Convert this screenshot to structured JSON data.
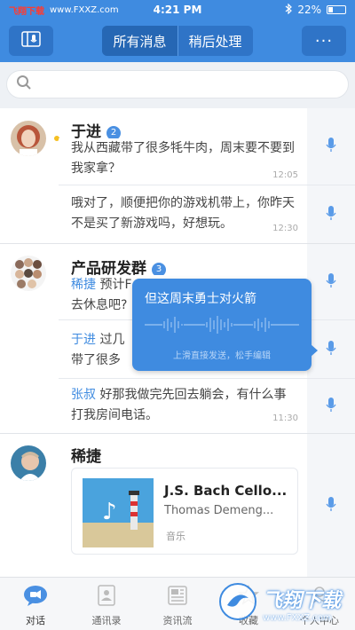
{
  "status_bar": {
    "watermark_text": "飞翔下载",
    "watermark_url": "www.FXXZ.com",
    "time": "4:21 PM",
    "battery": "22%"
  },
  "navbar": {
    "tabs": [
      {
        "label": "所有消息",
        "active": true
      },
      {
        "label": "稍后处理",
        "active": false
      }
    ],
    "more_label": "···"
  },
  "conversations": [
    {
      "name": "于进",
      "badge": "2",
      "messages": [
        {
          "text": "我从西藏带了很多牦牛肉，周末要不要到我家拿？",
          "time": "12:05"
        },
        {
          "text": "哦对了，顺便把你的游戏机带上，你昨天不是买了新游戏吗，好想玩。",
          "time": "12:30"
        }
      ]
    },
    {
      "name": "产品研发群",
      "badge": "3",
      "messages": [
        {
          "sender": "稀捷",
          "text": " 预计F...去休息吧?",
          "line1": " 预计F",
          "line2": "去休息吧?",
          "time": ""
        },
        {
          "sender": "于进",
          "text": " 过几...带了很多",
          "line1": " 过几",
          "line2": "带了很多",
          "time": ""
        },
        {
          "sender": "张叔",
          "text": " 好那我做完先回去躺会，有什么事打我房间电话。",
          "line1": " 好那我做完先回去躺会，有什么事",
          "line2": "打我房间电话。",
          "time": "11:30"
        }
      ]
    },
    {
      "name": "稀捷",
      "music": {
        "title": "J.S. Bach Cello...",
        "artist": "Thomas Demeng...",
        "category": "音乐"
      }
    }
  ],
  "voice_popup": {
    "text": "但这周末勇士对火箭",
    "hint": "上滑直接发送，松手编辑"
  },
  "tabbar": {
    "tabs": [
      {
        "label": "对话",
        "active": true
      },
      {
        "label": "通讯录",
        "active": false
      },
      {
        "label": "资讯流",
        "active": false
      },
      {
        "label": "收藏",
        "active": false
      },
      {
        "label": "个人中心",
        "active": false
      }
    ]
  },
  "watermark_bottom": {
    "text": "飞翔下载",
    "url": "www.FXXZ.com"
  },
  "colors": {
    "brand": "#3f8be0",
    "badge": "#4a90e2",
    "online_dot": "#f5c023"
  }
}
